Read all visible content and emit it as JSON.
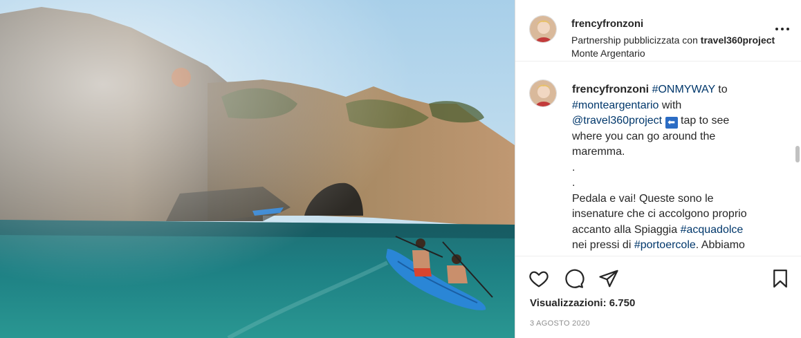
{
  "post": {
    "media": {
      "alt": ""
    },
    "header": {
      "username": "frencyfronzoni",
      "partnership_prefix": "Partnership pubblicizzata con ",
      "partner": "travel360project",
      "location": "Monte Argentario"
    },
    "caption": {
      "username": "frencyfronzoni",
      "hashtag_onmyway": "#ONMYWAY",
      "to": " to",
      "hashtag_monteargentario": "#monteargentario",
      "with": " with",
      "mention_travel360": "@travel360project",
      "arrow_emoji": "⬅",
      "line3_rest": " tap to see",
      "line4": "where you can go around the",
      "line5": "maremma.",
      "dot1": ".",
      "dot2": ".",
      "line8": "Pedala e vai! Queste sono le",
      "line9": "insenature che ci accolgono proprio",
      "line10_prefix": "accanto alla Spiaggia ",
      "hashtag_acquadolce": "#acquadolce",
      "line11_prefix": "nei pressi di ",
      "hashtag_portoercole": "#portoercole",
      "line11_suffix": ". Abbiamo"
    },
    "actions": {
      "icons": [
        "heart-icon",
        "comment-icon",
        "share-icon",
        "bookmark-icon"
      ]
    },
    "views_label": "Visualizzazioni: 6.750",
    "date": "3 AGOSTO 2020"
  },
  "colors": {
    "link": "#00376b",
    "text": "#262626",
    "muted": "#8e8e8e",
    "border": "#dbdbdb"
  }
}
